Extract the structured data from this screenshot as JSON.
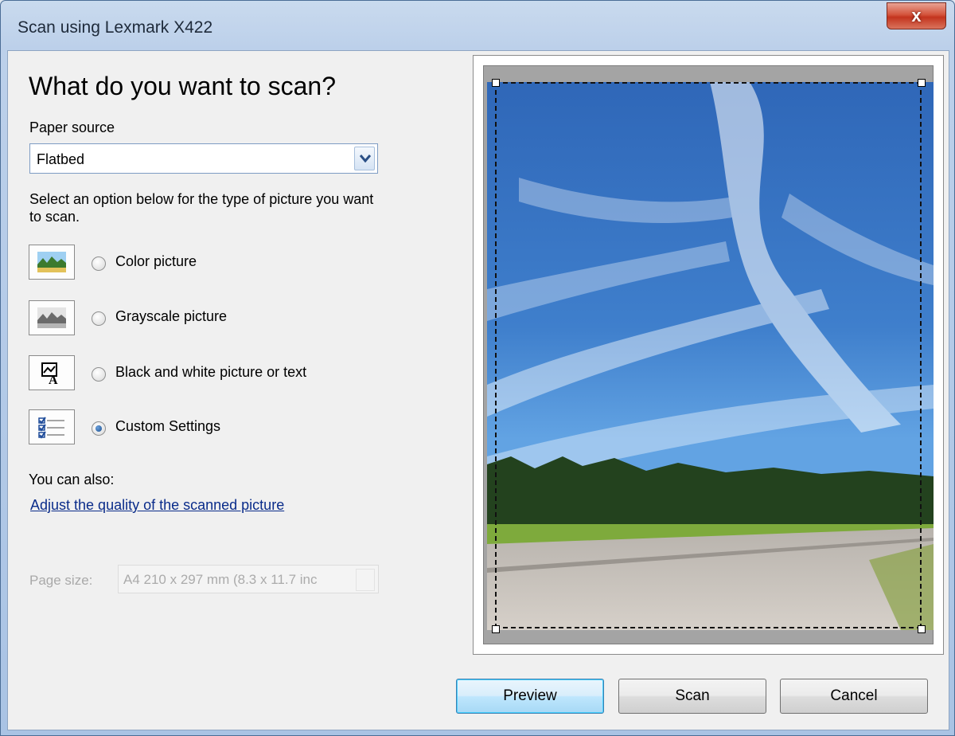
{
  "window": {
    "title": "Scan using Lexmark X422",
    "close_glyph": "x"
  },
  "left": {
    "heading": "What do you want to scan?",
    "paper_source_label": "Paper source",
    "paper_source_value": "Flatbed",
    "description": "Select an option below for the type of picture you want to scan.",
    "options": [
      {
        "label": "Color picture",
        "icon": "color-picture-icon",
        "checked": false
      },
      {
        "label": "Grayscale picture",
        "icon": "grayscale-picture-icon",
        "checked": false
      },
      {
        "label": "Black and white picture or text",
        "icon": "bw-picture-text-icon",
        "checked": false
      },
      {
        "label": "Custom Settings",
        "icon": "custom-settings-icon",
        "checked": true
      }
    ],
    "also_label": "You can also:",
    "adjust_link": "Adjust the quality of the scanned picture",
    "page_size_label": "Page size:",
    "page_size_value": "A4 210 x 297 mm (8.3 x 11.7 inc"
  },
  "buttons": {
    "preview": "Preview",
    "scan": "Scan",
    "cancel": "Cancel"
  },
  "colors": {
    "link": "#0a2c8a",
    "close": "#c3341e",
    "default_button": "#bee6fd"
  }
}
